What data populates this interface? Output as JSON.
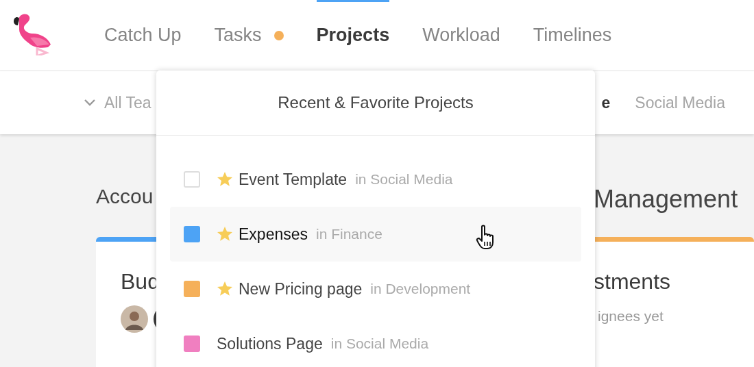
{
  "nav": {
    "tabs": [
      {
        "label": "Catch Up",
        "selected": false,
        "notification": false
      },
      {
        "label": "Tasks",
        "selected": false,
        "notification": true
      },
      {
        "label": "Projects",
        "selected": true,
        "notification": false
      },
      {
        "label": "Workload",
        "selected": false,
        "notification": false
      },
      {
        "label": "Timelines",
        "selected": false,
        "notification": false
      }
    ]
  },
  "filters": {
    "team": {
      "label": "All Tea"
    },
    "projects": [
      {
        "label": "e",
        "selected": true
      },
      {
        "label": "Social Media",
        "selected": false
      }
    ]
  },
  "main": {
    "headings": [
      "Accou",
      "Management"
    ],
    "cards": [
      {
        "title": "Bud",
        "color": "#4da3f5",
        "avatars": [
          {
            "kind": "photo"
          },
          {
            "kind": "dark"
          }
        ]
      },
      {
        "title": "stments",
        "color": "#f5b05a",
        "note": "ignees yet"
      }
    ]
  },
  "dropdown": {
    "title": "Recent & Favorite Projects",
    "items": [
      {
        "name": "Event Template",
        "context": "in Social Media",
        "starred": true,
        "highlighted": false
      },
      {
        "name": "Expenses",
        "context": "in Finance",
        "starred": true,
        "highlighted": true,
        "color": "#4da3f5"
      },
      {
        "name": "New Pricing page",
        "context": "in Development",
        "starred": true,
        "highlighted": false,
        "color": "#f5b05a"
      },
      {
        "name": "Solutions Page",
        "context": "in Social Media",
        "starred": false,
        "highlighted": false,
        "color": "#f07fc0"
      }
    ]
  }
}
